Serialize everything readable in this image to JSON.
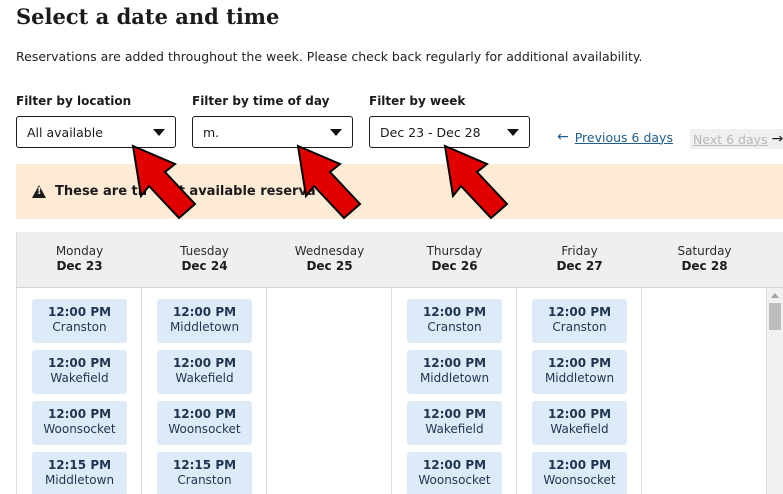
{
  "title": "Select a date and time",
  "intro": "Reservations are added throughout the week. Please check back regularly for additional availability.",
  "filters": {
    "location": {
      "label": "Filter by location",
      "value": "All available"
    },
    "time": {
      "label": "Filter by time of day",
      "value": "m."
    },
    "week": {
      "label": "Filter by week",
      "value": "Dec 23 - Dec 28"
    }
  },
  "nav": {
    "prev_label": "Previous 6 days",
    "next_label": "Next 6 days"
  },
  "alert": {
    "text": "These are th       t available reserva",
    "icon": "warning-icon"
  },
  "days": [
    {
      "name": "Monday",
      "date": "Dec 23",
      "slots": [
        {
          "time": "12:00 PM",
          "location": "Cranston"
        },
        {
          "time": "12:00 PM",
          "location": "Wakefield"
        },
        {
          "time": "12:00 PM",
          "location": "Woonsocket"
        },
        {
          "time": "12:15 PM",
          "location": "Middletown"
        }
      ]
    },
    {
      "name": "Tuesday",
      "date": "Dec 24",
      "slots": [
        {
          "time": "12:00 PM",
          "location": "Middletown"
        },
        {
          "time": "12:00 PM",
          "location": "Wakefield"
        },
        {
          "time": "12:00 PM",
          "location": "Woonsocket"
        },
        {
          "time": "12:15 PM",
          "location": "Cranston"
        }
      ]
    },
    {
      "name": "Wednesday",
      "date": "Dec 25",
      "slots": []
    },
    {
      "name": "Thursday",
      "date": "Dec 26",
      "slots": [
        {
          "time": "12:00 PM",
          "location": "Cranston"
        },
        {
          "time": "12:00 PM",
          "location": "Middletown"
        },
        {
          "time": "12:00 PM",
          "location": "Wakefield"
        },
        {
          "time": "12:00 PM",
          "location": "Woonsocket"
        }
      ]
    },
    {
      "name": "Friday",
      "date": "Dec 27",
      "slots": [
        {
          "time": "12:00 PM",
          "location": "Cranston"
        },
        {
          "time": "12:00 PM",
          "location": "Middletown"
        },
        {
          "time": "12:00 PM",
          "location": "Wakefield"
        },
        {
          "time": "12:00 PM",
          "location": "Woonsocket"
        }
      ]
    },
    {
      "name": "Saturday",
      "date": "Dec 28",
      "slots": []
    }
  ],
  "colors": {
    "slot_bg": "#dcebf7",
    "alert_bg": "#fdebd6",
    "annotation_arrow": "#e00000",
    "link": "#1f5d8c"
  }
}
